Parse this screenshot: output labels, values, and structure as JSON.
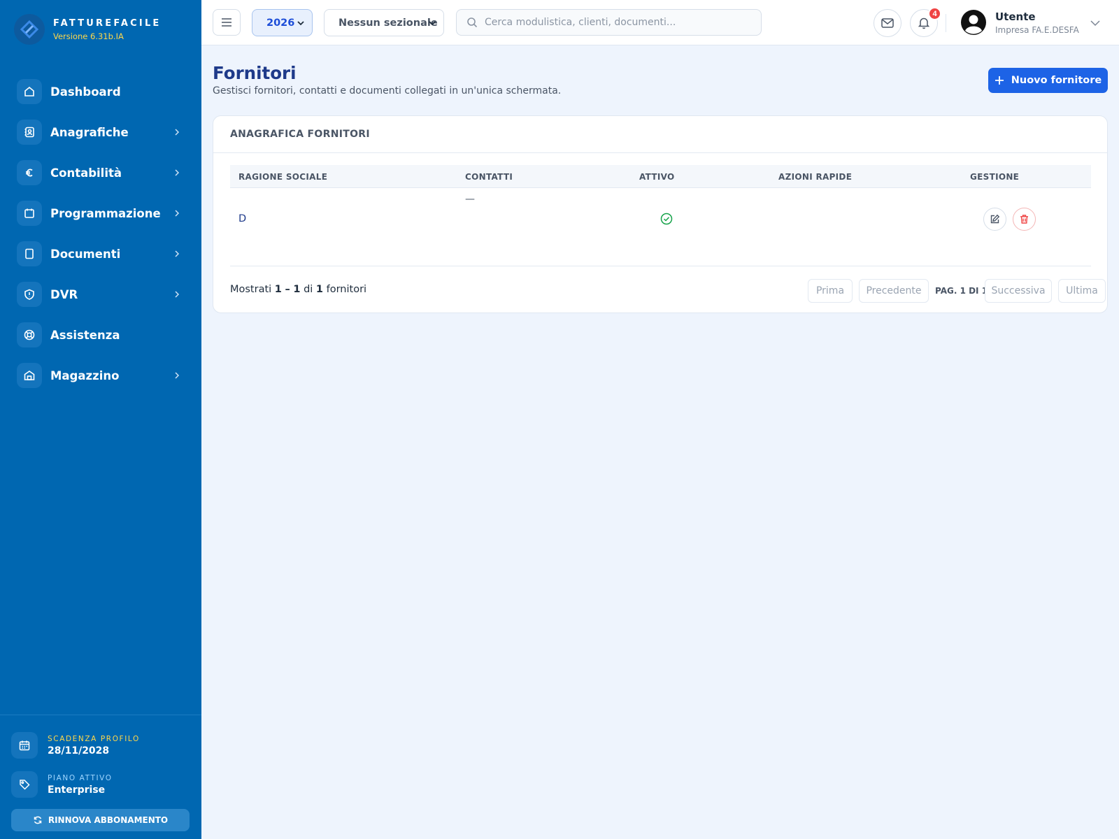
{
  "brand": {
    "name": "FATTUREFACILE",
    "version": "Versione 6.31b.IA"
  },
  "sidebar": {
    "items": [
      {
        "label": "Dashboard",
        "icon": "home-icon",
        "has_children": false
      },
      {
        "label": "Anagrafiche",
        "icon": "contacts-icon",
        "has_children": true
      },
      {
        "label": "Contabilità",
        "icon": "euro-icon",
        "has_children": true
      },
      {
        "label": "Programmazione",
        "icon": "calendar-icon",
        "has_children": true
      },
      {
        "label": "Documenti",
        "icon": "document-icon",
        "has_children": true
      },
      {
        "label": "DVR",
        "icon": "shield-icon",
        "has_children": true
      },
      {
        "label": "Assistenza",
        "icon": "lifebuoy-icon",
        "has_children": false
      },
      {
        "label": "Magazzino",
        "icon": "warehouse-icon",
        "has_children": true
      }
    ],
    "footer": {
      "expiry_label": "SCADENZA PROFILO",
      "expiry_value": "28/11/2028",
      "plan_label": "PIANO ATTIVO",
      "plan_value": "Enterprise",
      "renew_label": "RINNOVA ABBONAMENTO"
    }
  },
  "topbar": {
    "year": "2026",
    "sezionale": "Nessun sezionale",
    "search_placeholder": "Cerca modulistica, clienti, documenti...",
    "notifications_count": "4",
    "user_name": "Utente",
    "user_company": "Impresa FA.E.DESFA"
  },
  "page": {
    "title": "Fornitori",
    "subtitle": "Gestisci fornitori, contatti e documenti collegati in un'unica schermata.",
    "new_button": "Nuovo fornitore"
  },
  "card": {
    "title": "ANAGRAFICA FORNITORI",
    "columns": [
      "RAGIONE SOCIALE",
      "CONTATTI",
      "ATTIVO",
      "AZIONI RAPIDE",
      "GESTIONE"
    ],
    "rows": [
      {
        "name": "D",
        "contacts": "—",
        "active": true
      }
    ],
    "footer": {
      "shown_prefix": "Mostrati",
      "shown_from": "1",
      "shown_sep": "–",
      "shown_to": "1",
      "shown_of": "di",
      "shown_total": "1",
      "shown_suffix": "fornitori",
      "first": "Prima",
      "prev": "Precedente",
      "page_info": "PAG. 1 DI 1",
      "next": "Successiva",
      "last": "Ultima"
    }
  },
  "colors": {
    "sidebar": "#0067b1",
    "accent": "#1d63e6",
    "title": "#1e3a8a",
    "success": "#16a34a",
    "danger": "#ef4444",
    "badge": "#ef4444"
  }
}
